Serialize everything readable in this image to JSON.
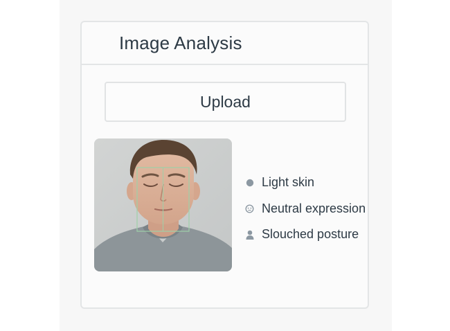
{
  "panel": {
    "title": "Image Analysis"
  },
  "upload": {
    "label": "Upload"
  },
  "photo": {
    "alt": "Man with eyes closed wearing grey t-shirt"
  },
  "attributes": [
    {
      "icon": "circle-icon",
      "label": "Light skin"
    },
    {
      "icon": "face-icon",
      "label": "Neutral expression"
    },
    {
      "icon": "person-icon",
      "label": "Slouched posture"
    }
  ],
  "colors": {
    "text": "#2d3a45",
    "icon": "#8c98a2",
    "face_box": "#9ed0a8",
    "panel_border": "#e3e5e6"
  }
}
